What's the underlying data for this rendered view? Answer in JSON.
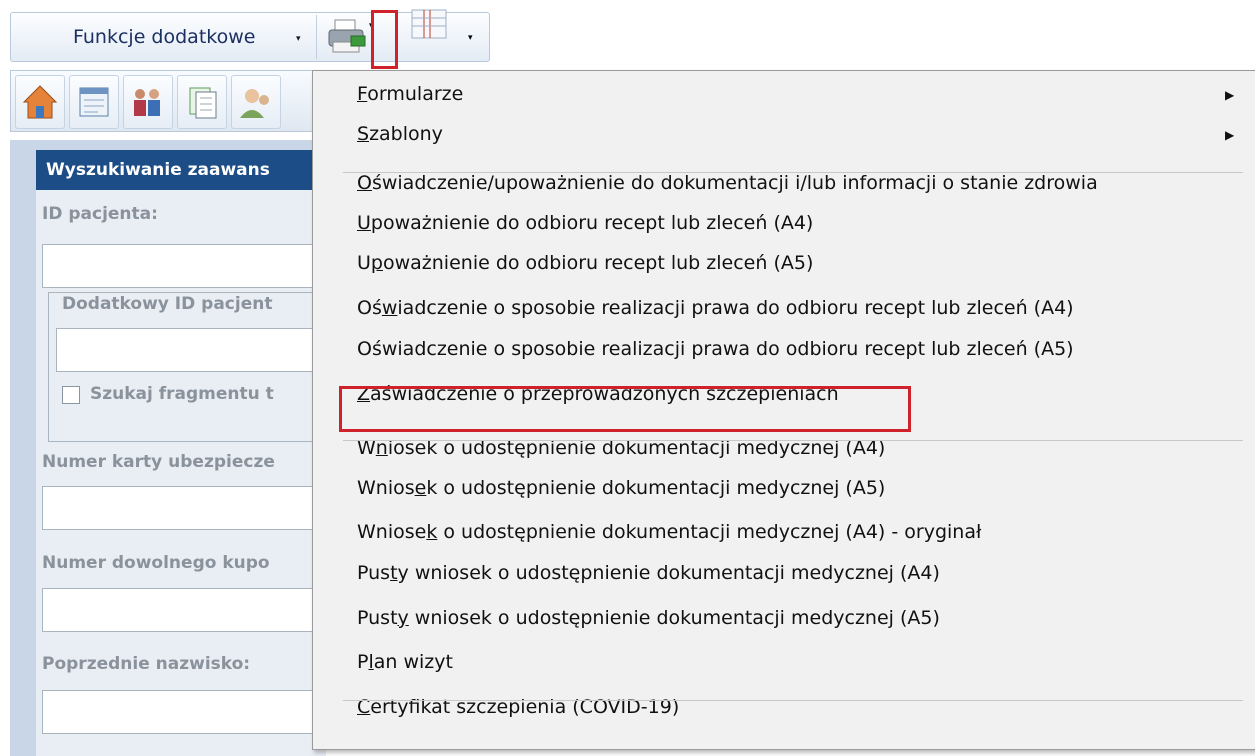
{
  "toolbar": {
    "functions_label": "Funkcje dodatkowe",
    "dropdown_glyph": "▾"
  },
  "iconbar": {
    "icons": [
      "home-icon",
      "calendar-card-icon",
      "people-group-icon",
      "documents-icon",
      "users-icon"
    ]
  },
  "panel": {
    "title": "Wyszukiwanie zaawans",
    "patient_id_label": "ID pacjenta:",
    "extra_id_label": "Dodatkowy ID pacjent",
    "search_fragment_label": "Szukaj fragmentu t",
    "insurance_card_label": "Numer karty ubezpiecze",
    "coupon_label": "Numer dowolnego kupo",
    "previous_surname_label": "Poprzednie nazwisko:"
  },
  "menu": {
    "submenu_arrow": "▶",
    "items": [
      {
        "pre": "",
        "u": "F",
        "post": "ormularze",
        "submenu": true
      },
      {
        "pre": "",
        "u": "S",
        "post": "zablony",
        "submenu": true
      },
      {
        "pre": "",
        "u": "O",
        "post": "świadczenie/upoważnienie do dokumentacji i/lub informacji o stanie zdrowia",
        "submenu": false
      },
      {
        "pre": "",
        "u": "U",
        "post": "poważnienie do odbioru recept lub zleceń (A4)",
        "submenu": false
      },
      {
        "pre": "U",
        "u": "p",
        "post": "oważnienie do odbioru recept lub zleceń (A5)",
        "submenu": false
      },
      {
        "pre": "Oś",
        "u": "w",
        "post": "iadczenie o sposobie realizacji prawa do odbioru recept lub zleceń (A4)",
        "submenu": false
      },
      {
        "pre": "Oświadczenie o sposobie realizacji prawa do odbioru recept lub zleceń (A5)",
        "u": "",
        "post": "",
        "submenu": false
      },
      {
        "pre": "",
        "u": "Z",
        "post": "aświadczenie o przeprowadzonych szczepieniach",
        "submenu": false
      },
      {
        "pre": "W",
        "u": "n",
        "post": "iosek o udostępnienie dokumentacji medycznej (A4)",
        "submenu": false
      },
      {
        "pre": "Wnios",
        "u": "e",
        "post": "k o udostępnienie dokumentacji medycznej (A5)",
        "submenu": false
      },
      {
        "pre": "Wniose",
        "u": "k",
        "post": " o udostępnienie dokumentacji medycznej (A4) - oryginał",
        "submenu": false
      },
      {
        "pre": "Pus",
        "u": "t",
        "post": "y wniosek o udostępnienie dokumentacji medycznej (A4)",
        "submenu": false
      },
      {
        "pre": "Pust",
        "u": "y",
        "post": " wniosek o udostępnienie dokumentacji medycznej (A5)",
        "submenu": false
      },
      {
        "pre": "P",
        "u": "l",
        "post": "an wizyt",
        "submenu": false
      },
      {
        "pre": "",
        "u": "C",
        "post": "ertyfikat szczepienia (COVID-19)",
        "submenu": false
      }
    ]
  }
}
